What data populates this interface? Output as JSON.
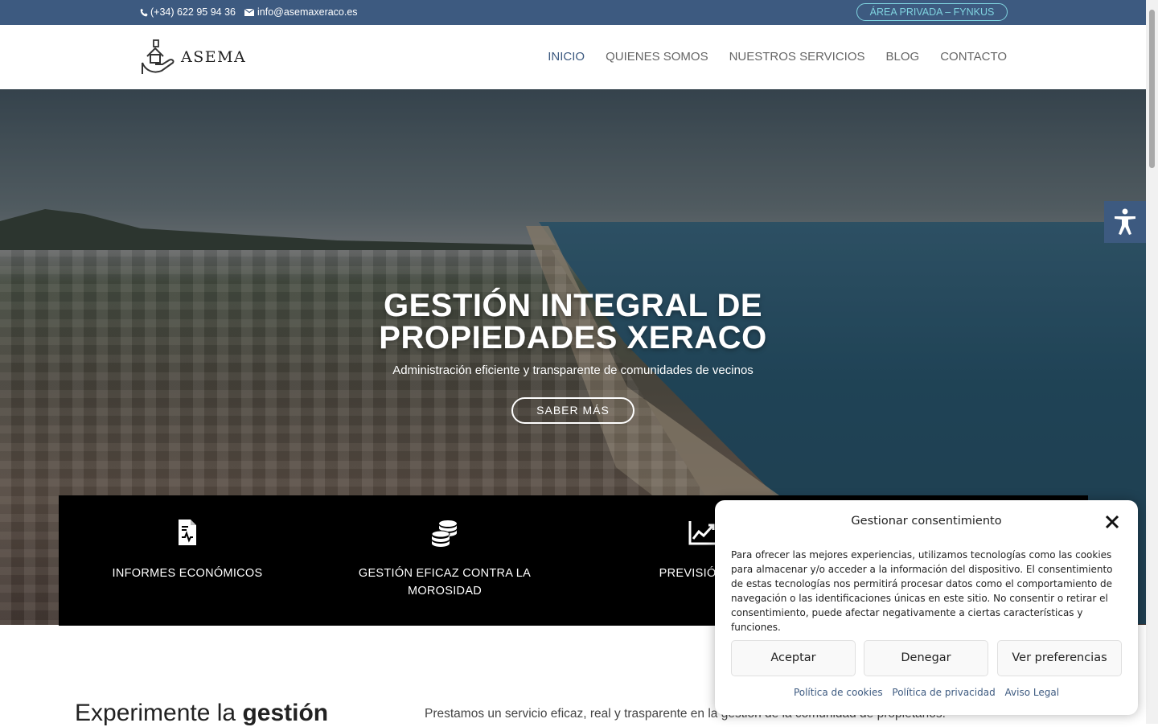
{
  "topbar": {
    "phone": "(+34) 622 95 94 36",
    "email": "info@asemaxeraco.es",
    "private_area": "ÁREA PRIVADA – FYNKUS"
  },
  "header": {
    "logo_text": "ASEMA",
    "nav": [
      "INICIO",
      "QUIENES SOMOS",
      "NUESTROS SERVICIOS",
      "BLOG",
      "CONTACTO"
    ]
  },
  "hero": {
    "title_line1": "GESTIÓN INTEGRAL DE",
    "title_line2": "PROPIEDADES XERACO",
    "subtitle": "Administración eficiente y transparente de comunidades de vecinos",
    "button": "SABER MÁS"
  },
  "features": [
    {
      "label": "INFORMES ECONÓMICOS",
      "icon": "document-chart-icon"
    },
    {
      "label": "GESTIÓN EFICAZ CONTRA LA MOROSIDAD",
      "icon": "coins-icon"
    },
    {
      "label": "PREVISIÓN DE",
      "icon": "line-chart-icon"
    }
  ],
  "content": {
    "heading_pre": "Experimente la ",
    "heading_bold": "gestión",
    "paragraph": "Prestamos un servicio eficaz, real y trasparente en la gestión de la comunidad de propietarios."
  },
  "consent": {
    "title": "Gestionar consentimiento",
    "text": "Para ofrecer las mejores experiencias, utilizamos tecnologías como las cookies para almacenar y/o acceder a la información del dispositivo. El consentimiento de estas tecnologías nos permitirá procesar datos como el comportamiento de navegación o las identificaciones únicas en este sitio. No consentir o retirar el consentimiento, puede afectar negativamente a ciertas características y funciones.",
    "accept": "Aceptar",
    "deny": "Denegar",
    "preferences": "Ver preferencias",
    "links": [
      "Política de cookies",
      "Política de privacidad",
      "Aviso Legal"
    ]
  },
  "colors": {
    "brand": "#3d5a80",
    "accent": "#7fd3df"
  }
}
